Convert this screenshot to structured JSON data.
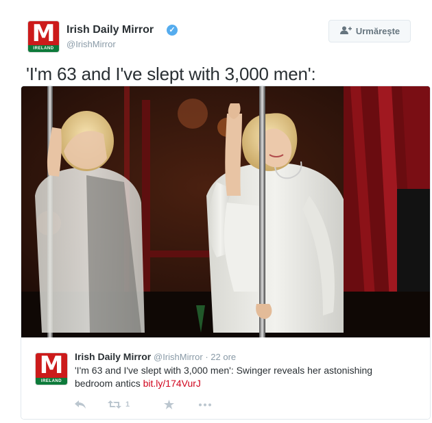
{
  "author": {
    "name": "Irish Daily Mirror",
    "handle": "@IrishMirror",
    "logo_letter": "M",
    "logo_sub": "IRELAND",
    "verified_glyph": "✓"
  },
  "follow_button": {
    "label": "Urmărește",
    "icon": "add-user-icon"
  },
  "tweet": {
    "text": "'I'm 63 and I've slept with 3,000 men':"
  },
  "card": {
    "image_icon": "photo-woman-pole",
    "quoted": {
      "name": "Irish Daily Mirror",
      "handle": "@IrishMirror",
      "separator": "·",
      "time": "22 ore",
      "text": "'I'm 63 and I've slept with 3,000 men': Swinger reveals her astonishing bedroom antics",
      "link": "bit.ly/174VurJ",
      "logo_letter": "M",
      "logo_sub": "IRELAND"
    },
    "actions": {
      "reply_icon": "reply-icon",
      "retweet_icon": "retweet-icon",
      "retweet_count": "1",
      "favorite_icon": "star-icon",
      "more_icon": "more-dots-icon"
    }
  },
  "colors": {
    "brand_red": "#cc1b1b",
    "brand_green": "#0d7a3a",
    "link": "#d0021b",
    "muted": "#8899a6",
    "verified": "#55acee"
  }
}
